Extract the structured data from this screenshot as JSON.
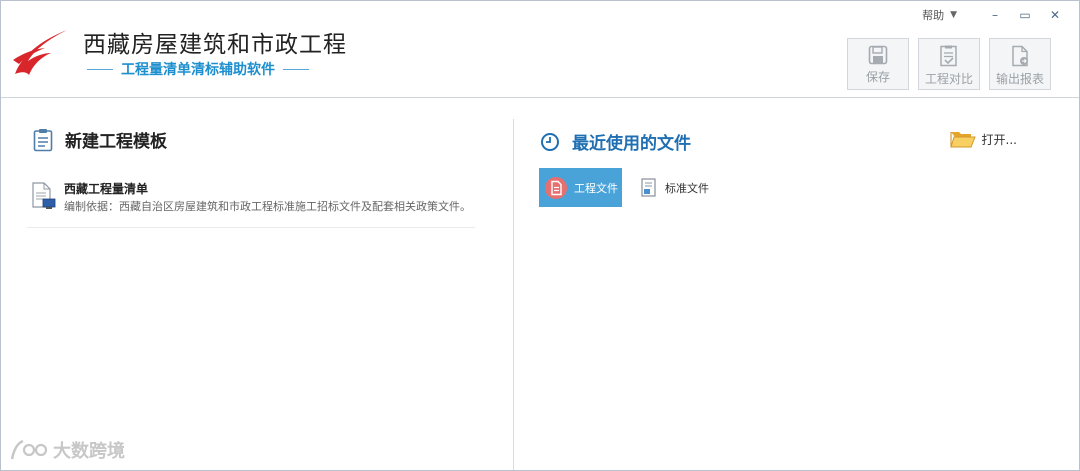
{
  "app": {
    "title": "西藏房屋建筑和市政工程",
    "subtitle": "工程量清单清标辅助软件"
  },
  "window_controls": {
    "help_label": "帮助",
    "help_caret": "▼",
    "minimize": "–",
    "maximize": "▭",
    "close": "✕"
  },
  "toolbar": {
    "save_label": "保存",
    "compare_label": "工程对比",
    "export_label": "输出报表"
  },
  "left_panel": {
    "title": "新建工程模板",
    "templates": [
      {
        "name": "西藏工程量清单",
        "description": "编制依据：西藏自治区房屋建筑和市政工程标准施工招标文件及配套相关政策文件。"
      }
    ]
  },
  "right_panel": {
    "title": "最近使用的文件",
    "open_label": "打开...",
    "tabs": [
      {
        "label": "工程文件",
        "active": true
      },
      {
        "label": "标准文件",
        "active": false
      }
    ]
  },
  "watermark": {
    "text": "大数跨境"
  },
  "colors": {
    "accent_blue": "#1d8fcf",
    "active_tab": "#4aa3d8",
    "logo_red": "#d8262b",
    "section_blue": "#1f6fb2"
  }
}
